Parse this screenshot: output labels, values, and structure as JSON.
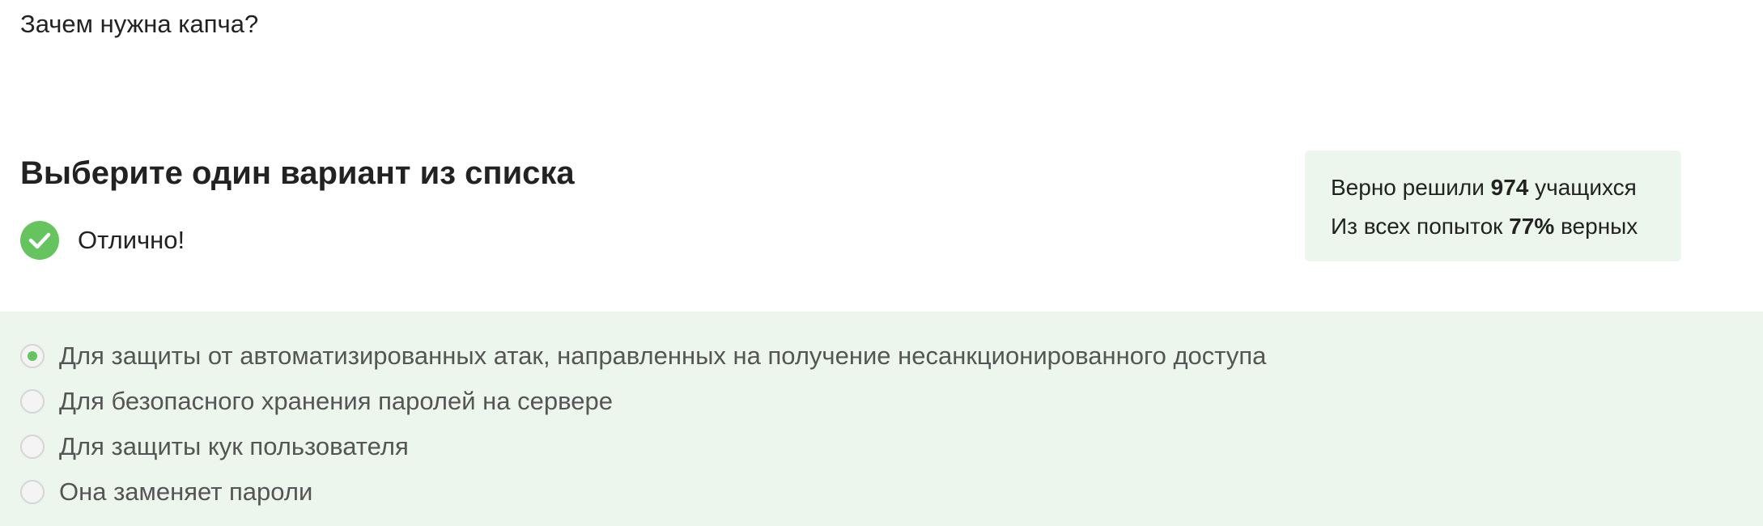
{
  "question": {
    "text": "Зачем нужна капча?"
  },
  "instruction": {
    "text": "Выберите один вариант из списка"
  },
  "feedback": {
    "text": "Отлично!",
    "icon": "check-circle-icon",
    "color": "#66c45f"
  },
  "stats": {
    "line1_prefix": "Верно решили ",
    "line1_value": "974",
    "line1_suffix": " учащихся",
    "line2_prefix": "Из всех попыток ",
    "line2_value": "77%",
    "line2_suffix": " верных",
    "background": "#ecf6ec"
  },
  "options": {
    "background": "#ecf6ec",
    "items": [
      {
        "label": "Для защиты от автоматизированных атак, направленных на получение несанкционированного доступа",
        "selected": true
      },
      {
        "label": "Для безопасного хранения паролей на сервере",
        "selected": false
      },
      {
        "label": "Для защиты кук пользователя",
        "selected": false
      },
      {
        "label": "Она заменяет пароли",
        "selected": false
      }
    ]
  }
}
